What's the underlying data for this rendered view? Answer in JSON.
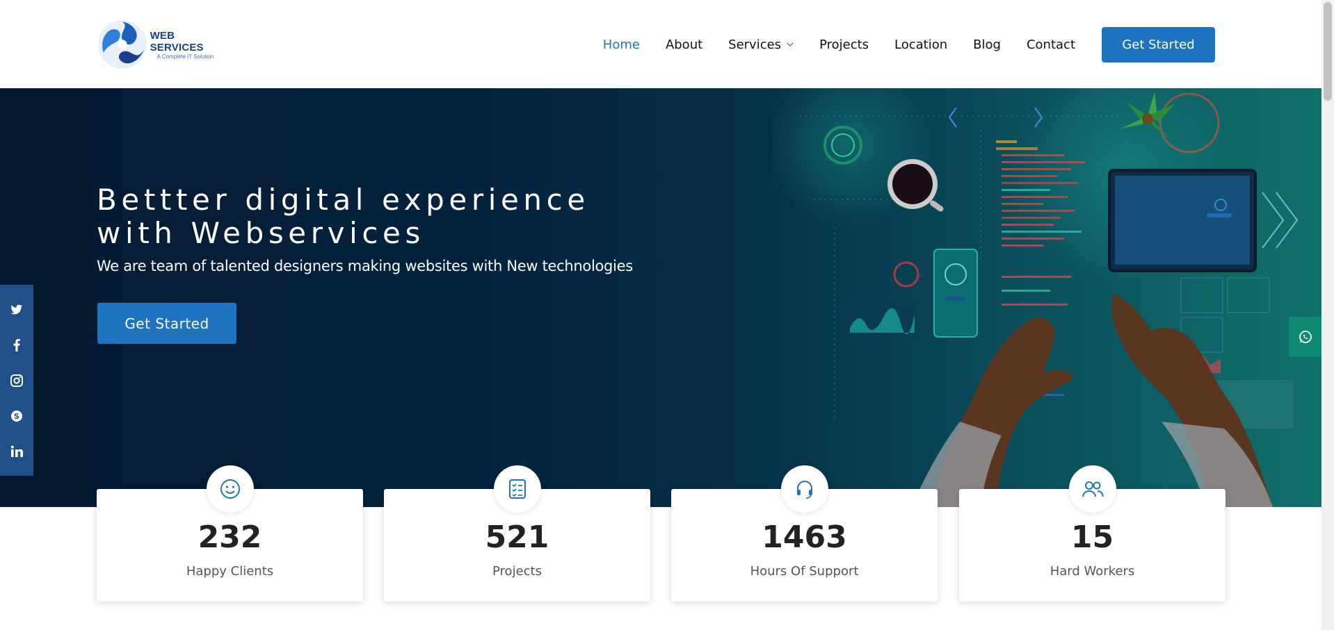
{
  "brand": {
    "name": "WEB SERVICES",
    "tagline": "A Complete IT Solution"
  },
  "nav": {
    "items": [
      {
        "label": "Home",
        "active": true
      },
      {
        "label": "About"
      },
      {
        "label": "Services",
        "has_dropdown": true
      },
      {
        "label": "Projects"
      },
      {
        "label": "Location"
      },
      {
        "label": "Blog"
      },
      {
        "label": "Contact"
      }
    ],
    "cta_label": "Get Started"
  },
  "hero": {
    "title": "Bettter digital experience with Webservices",
    "subtitle": "We are team of talented designers making websites with New technologies",
    "cta_label": "Get Started"
  },
  "social": [
    {
      "icon": "twitter-icon",
      "glyph": "t"
    },
    {
      "icon": "facebook-icon",
      "glyph": "f"
    },
    {
      "icon": "instagram-icon",
      "glyph": "◎"
    },
    {
      "icon": "skype-icon",
      "glyph": "S"
    },
    {
      "icon": "linkedin-icon",
      "glyph": "in"
    }
  ],
  "stats": [
    {
      "value": "232",
      "label": "Happy Clients",
      "icon": "smiley-icon"
    },
    {
      "value": "521",
      "label": "Projects",
      "icon": "document-list-icon"
    },
    {
      "value": "1463",
      "label": "Hours Of Support",
      "icon": "headset-icon"
    },
    {
      "value": "15",
      "label": "Hard Workers",
      "icon": "people-icon"
    }
  ],
  "colors": {
    "accent": "#1e74c0",
    "hero_dark": "#041a30",
    "hero_teal": "#10706b",
    "social_bg": "#1e4f86",
    "whatsapp_bg": "#0f8a72"
  }
}
